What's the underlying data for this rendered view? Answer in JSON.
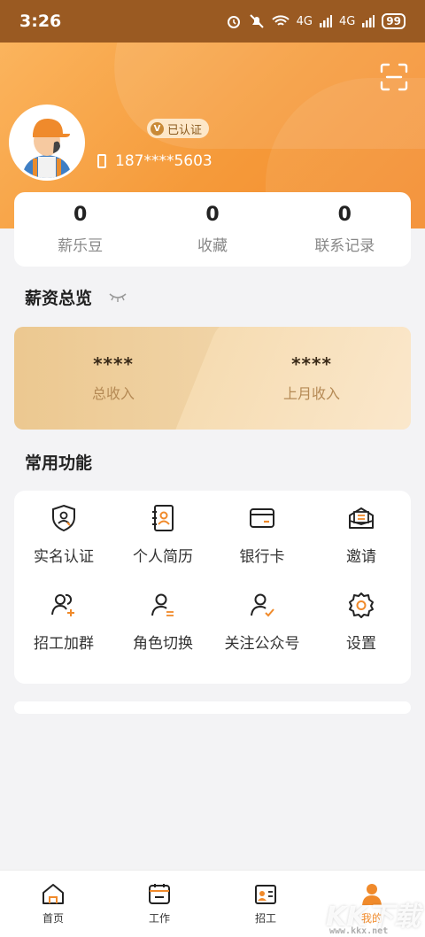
{
  "status_bar": {
    "time": "3:26",
    "network1": "4G",
    "network2": "4G",
    "battery": "99"
  },
  "profile": {
    "verified_label": "已认证",
    "verified_badge": "V",
    "phone": "187****5603"
  },
  "stats": [
    {
      "value": "0",
      "label": "薪乐豆"
    },
    {
      "value": "0",
      "label": "收藏"
    },
    {
      "value": "0",
      "label": "联系记录"
    }
  ],
  "salary": {
    "title": "薪资总览",
    "items": [
      {
        "value": "****",
        "label": "总收入"
      },
      {
        "value": "****",
        "label": "上月收入"
      }
    ]
  },
  "functions": {
    "title": "常用功能",
    "items": [
      {
        "label": "实名认证",
        "icon": "shield-user-icon"
      },
      {
        "label": "个人简历",
        "icon": "resume-icon"
      },
      {
        "label": "银行卡",
        "icon": "card-icon"
      },
      {
        "label": "邀请",
        "icon": "invite-icon"
      },
      {
        "label": "招工加群",
        "icon": "group-add-icon"
      },
      {
        "label": "角色切换",
        "icon": "switch-role-icon"
      },
      {
        "label": "关注公众号",
        "icon": "follow-icon"
      },
      {
        "label": "设置",
        "icon": "gear-icon"
      }
    ]
  },
  "tabbar": [
    {
      "label": "首页",
      "icon": "home-icon"
    },
    {
      "label": "工作",
      "icon": "calendar-icon"
    },
    {
      "label": "招工",
      "icon": "recruit-icon"
    },
    {
      "label": "我的",
      "icon": "profile-icon",
      "active": true
    }
  ],
  "watermark": {
    "text": "KK下载",
    "url": "www.kkx.net"
  },
  "colors": {
    "accent": "#f08a2b",
    "hero_start": "#fbb45d",
    "hero_end": "#f48c2e",
    "status_bar": "#9a5a22"
  }
}
